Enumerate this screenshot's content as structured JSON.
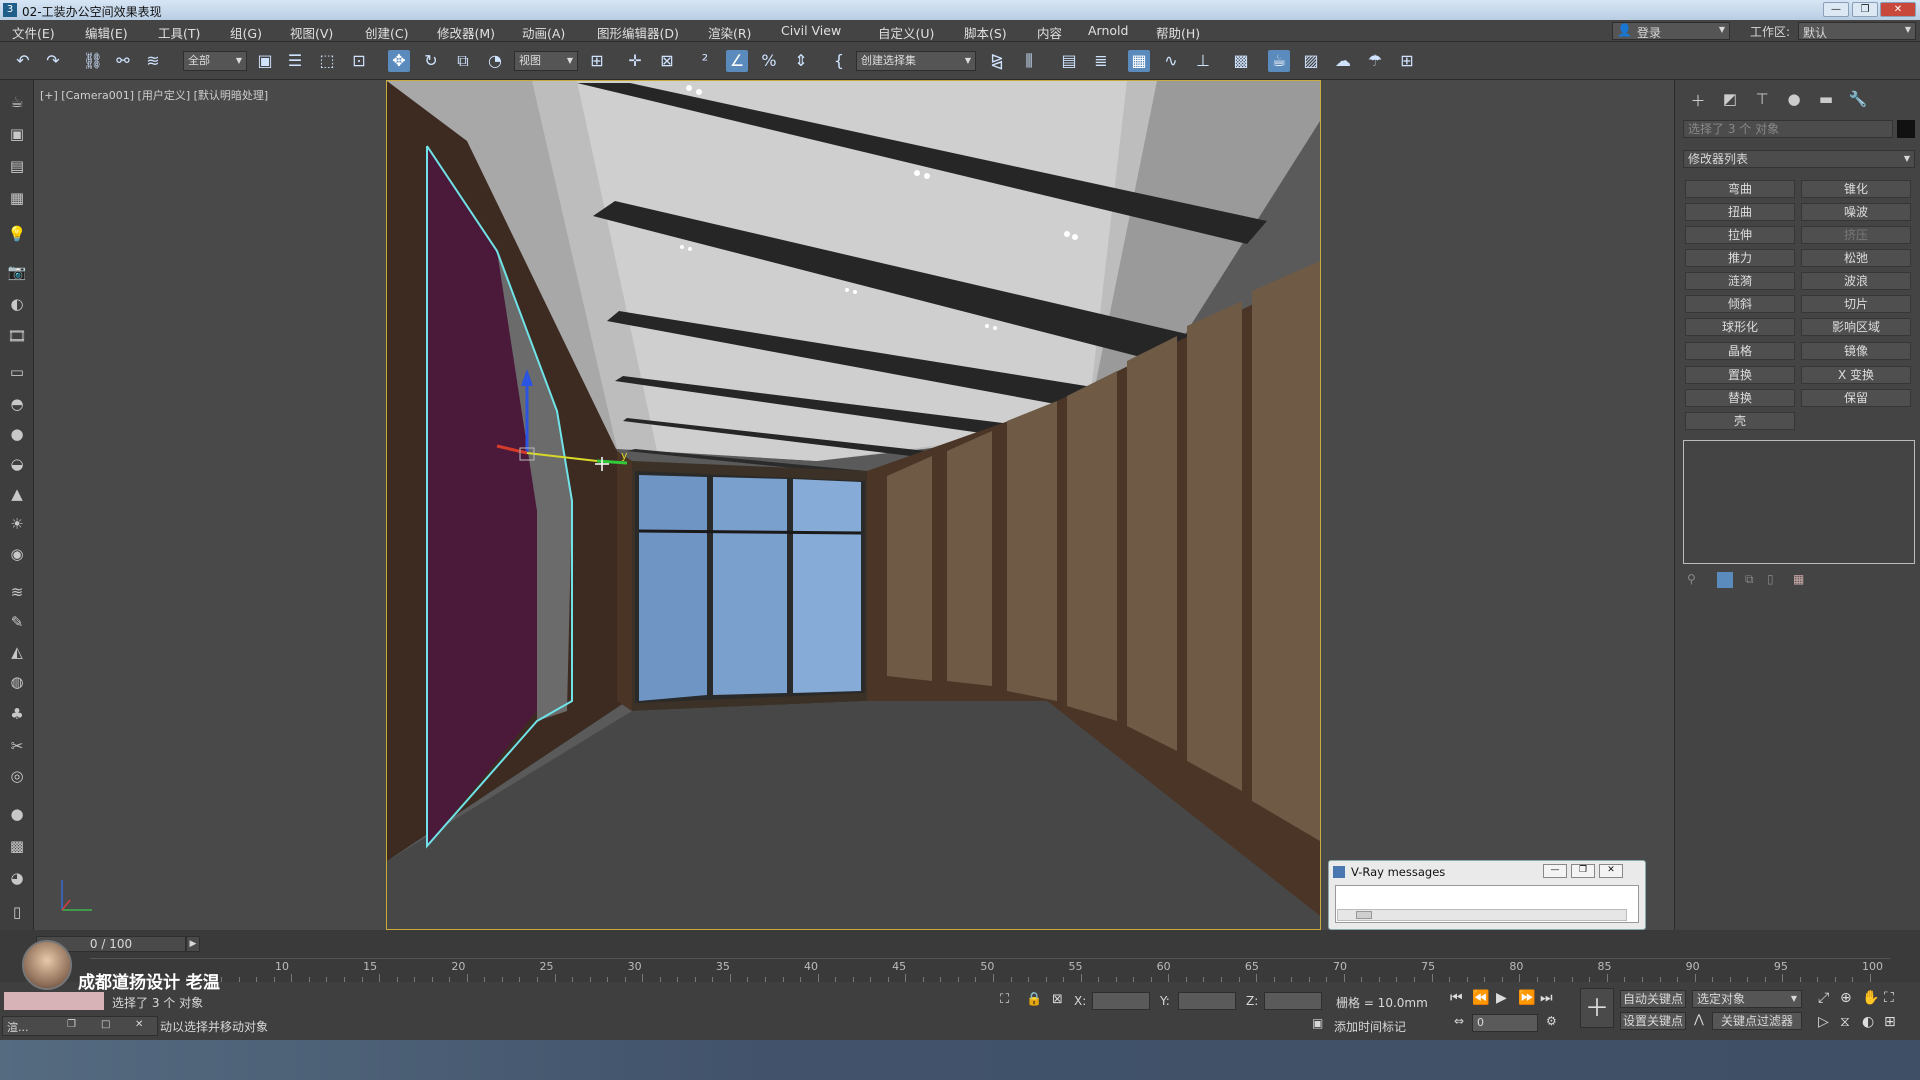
{
  "window": {
    "title": "02-工装办公空间效果表现",
    "icon": "3",
    "controls": [
      "—",
      "❐",
      "✕"
    ]
  },
  "menu": [
    "文件(E)",
    "编辑(E)",
    "工具(T)",
    "组(G)",
    "视图(V)",
    "创建(C)",
    "修改器(M)",
    "动画(A)",
    "图形编辑器(D)",
    "渲染(R)",
    "Civil View",
    "自定义(U)",
    "脚本(S)",
    "内容",
    "Arnold",
    "帮助(H)"
  ],
  "account": {
    "login": "登录",
    "workspace_label": "工作区:",
    "workspace_value": "默认"
  },
  "toolbar": {
    "filter_value": "全部",
    "coord_value": "视图",
    "selset_placeholder": "创建选择集"
  },
  "viewport": {
    "label": "[+] [Camera001] [用户定义] [默认明暗处理]",
    "axis_y": "y"
  },
  "cmdpanel": {
    "selection": "选择了 3 个 对象",
    "modifier_list": "修改器列表",
    "buttons": [
      [
        "弯曲",
        "锥化"
      ],
      [
        "扭曲",
        "噪波"
      ],
      [
        "拉伸",
        "挤压"
      ],
      [
        "推力",
        "松弛"
      ],
      [
        "涟漪",
        "波浪"
      ],
      [
        "倾斜",
        "切片"
      ],
      [
        "球形化",
        "影响区域"
      ],
      [
        "晶格",
        "镜像"
      ],
      [
        "置换",
        "X 变换"
      ],
      [
        "替换",
        "保留"
      ],
      [
        "壳",
        ""
      ]
    ],
    "dim_button": "挤压"
  },
  "vray": {
    "title": "V-Ray messages"
  },
  "timeline": {
    "frame": "0 / 100",
    "ticks": [
      "10",
      "15",
      "20",
      "25",
      "30",
      "35",
      "40",
      "45",
      "50",
      "55",
      "60",
      "65",
      "70",
      "75",
      "80",
      "85",
      "90",
      "95",
      "100"
    ]
  },
  "watermark": {
    "name": "成都道扬设计  老温"
  },
  "status": {
    "selection": "选择了 3 个 对象",
    "prompt": "动以选择并移动对象",
    "x_label": "X:",
    "y_label": "Y:",
    "z_label": "Z:",
    "grid": "栅格 = 10.0mm",
    "add_tag": "添加时间标记",
    "autokey": "自动关键点",
    "setkey": "设置关键点",
    "sel_obj": "选定对象",
    "key_filter": "关键点过滤器",
    "frame_field": "0"
  },
  "taskbar": {
    "app": "渲..."
  }
}
